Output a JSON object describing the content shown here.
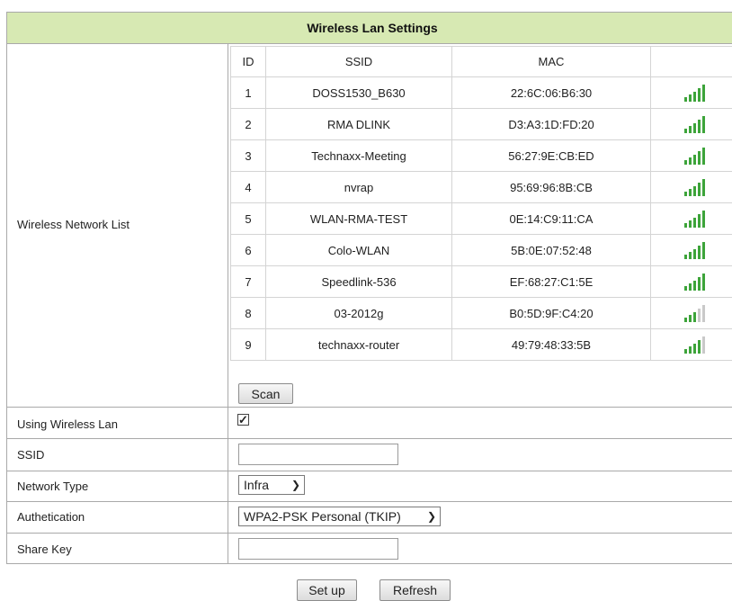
{
  "header": {
    "title": "Wireless Lan Settings"
  },
  "labels": {
    "network_list": "Wireless Network List",
    "using_wireless": "Using Wireless Lan",
    "ssid": "SSID",
    "network_type": "Network Type",
    "authentication": "Authetication",
    "share_key": "Share Key"
  },
  "networks": {
    "columns": [
      "ID",
      "SSID",
      "MAC",
      ""
    ],
    "rows": [
      {
        "id": "1",
        "ssid": "DOSS1530_B630",
        "mac": "22:6C:06:B6:30",
        "signal_bars": 5
      },
      {
        "id": "2",
        "ssid": "RMA DLINK",
        "mac": "D3:A3:1D:FD:20",
        "signal_bars": 5
      },
      {
        "id": "3",
        "ssid": "Technaxx-Meeting",
        "mac": "56:27:9E:CB:ED",
        "signal_bars": 5
      },
      {
        "id": "4",
        "ssid": "nvrap",
        "mac": "95:69:96:8B:CB",
        "signal_bars": 5
      },
      {
        "id": "5",
        "ssid": "WLAN-RMA-TEST",
        "mac": "0E:14:C9:11:CA",
        "signal_bars": 5
      },
      {
        "id": "6",
        "ssid": "Colo-WLAN",
        "mac": "5B:0E:07:52:48",
        "signal_bars": 5
      },
      {
        "id": "7",
        "ssid": "Speedlink-536",
        "mac": "EF:68:27:C1:5E",
        "signal_bars": 5
      },
      {
        "id": "8",
        "ssid": "03-2012g",
        "mac": "B0:5D:9F:C4:20",
        "signal_bars": 3
      },
      {
        "id": "9",
        "ssid": "technaxx-router",
        "mac": "49:79:48:33:5B",
        "signal_bars": 4
      }
    ]
  },
  "buttons": {
    "scan": "Scan",
    "setup": "Set up",
    "refresh": "Refresh"
  },
  "form": {
    "using_wireless_checked": true,
    "ssid_value": "",
    "network_type": "Infra",
    "authentication": "WPA2-PSK Personal (TKIP)",
    "share_key_value": ""
  },
  "colors": {
    "header_bg": "#d7e9b3",
    "signal_on": "#3da43a",
    "signal_off": "#c9c9c9"
  }
}
